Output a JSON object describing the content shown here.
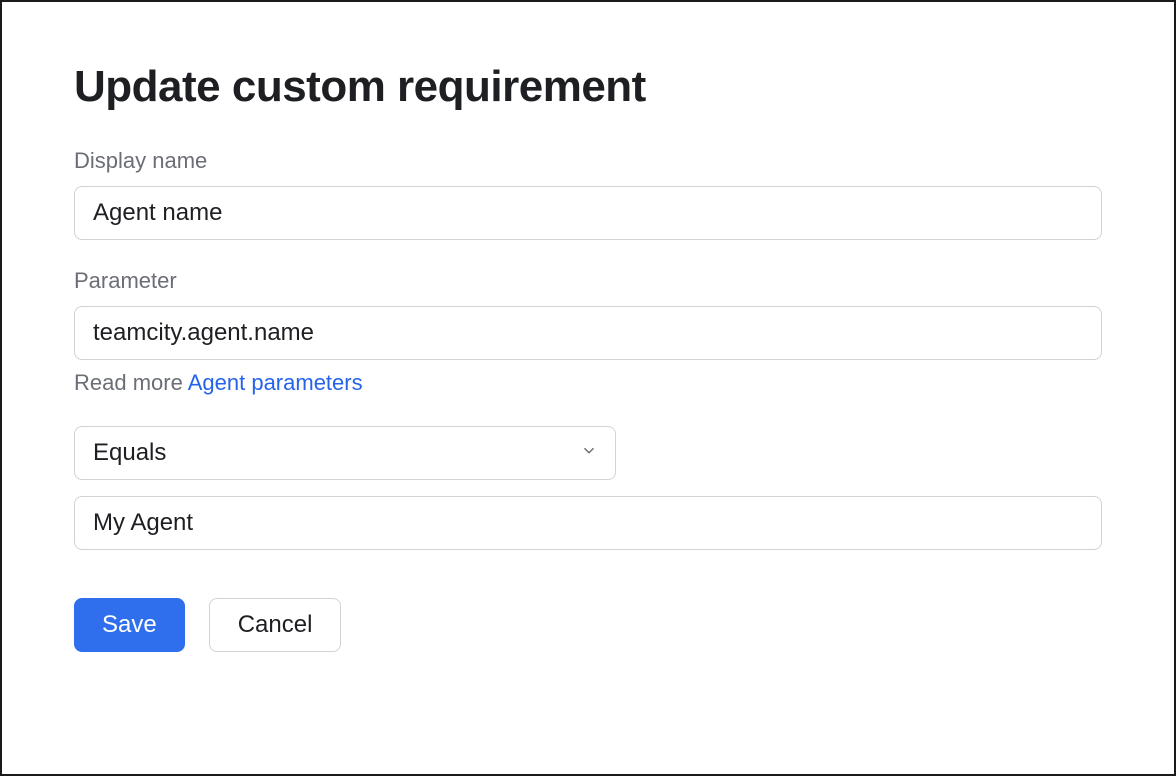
{
  "dialog": {
    "title": "Update custom requirement"
  },
  "fields": {
    "display_name": {
      "label": "Display name",
      "value": "Agent name"
    },
    "parameter": {
      "label": "Parameter",
      "value": "teamcity.agent.name",
      "help_prefix": "Read more ",
      "help_link_text": "Agent parameters"
    },
    "operator": {
      "selected": "Equals"
    },
    "value": {
      "value": "My Agent"
    }
  },
  "buttons": {
    "save": "Save",
    "cancel": "Cancel"
  }
}
